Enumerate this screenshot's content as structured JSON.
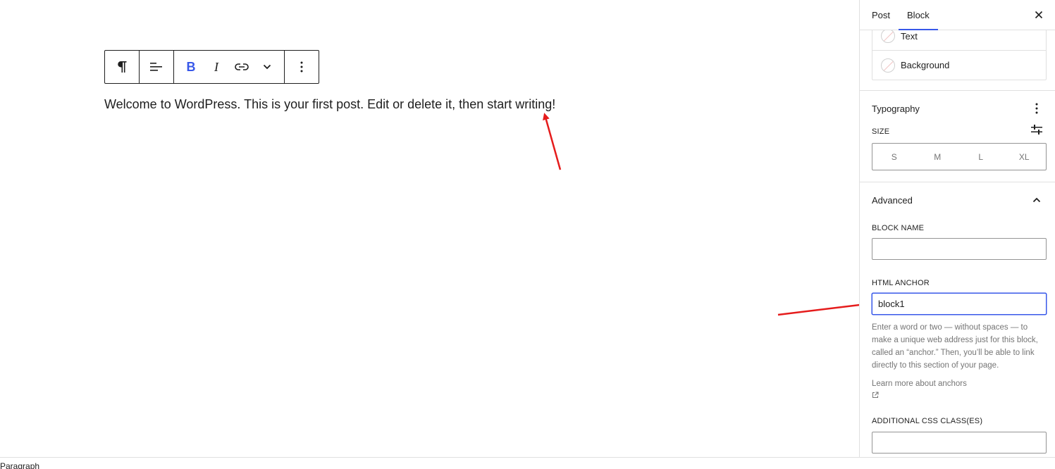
{
  "editor": {
    "paragraph_text": "Welcome to WordPress. This is your first post. Edit or delete it, then start writing!"
  },
  "toolbar": {
    "block_type_icon": "paragraph-icon",
    "align_icon": "align-left-icon",
    "bold_label": "B",
    "italic_label": "I",
    "link_icon": "link-icon",
    "more_icon": "chevron-down-icon",
    "options_icon": "more-vertical-icon"
  },
  "sidebar": {
    "tabs": [
      {
        "label": "Post",
        "active": false
      },
      {
        "label": "Block",
        "active": true
      }
    ],
    "close_icon": "close-icon",
    "color": {
      "items": [
        {
          "label": "Text"
        },
        {
          "label": "Background"
        }
      ]
    },
    "typography": {
      "title": "Typography",
      "size_label": "SIZE",
      "sizes": [
        "S",
        "M",
        "L",
        "XL"
      ]
    },
    "advanced": {
      "title": "Advanced",
      "block_name_label": "BLOCK NAME",
      "block_name_value": "",
      "html_anchor_label": "HTML ANCHOR",
      "html_anchor_value": "block1",
      "help_text": "Enter a word or two — without spaces — to make a unique web address just for this block, called an “anchor.” Then, you’ll be able to link directly to this section of your page.",
      "learn_more": "Learn more about anchors",
      "css_class_label": "ADDITIONAL CSS CLASS(ES)",
      "css_class_value": ""
    }
  },
  "footer": {
    "breadcrumb": "Paragraph"
  },
  "colors": {
    "accent": "#3858e9",
    "annotation_arrow": "#e51c1c",
    "border": "#e0e0e0",
    "text": "#1e1e1e",
    "muted": "#757575"
  }
}
